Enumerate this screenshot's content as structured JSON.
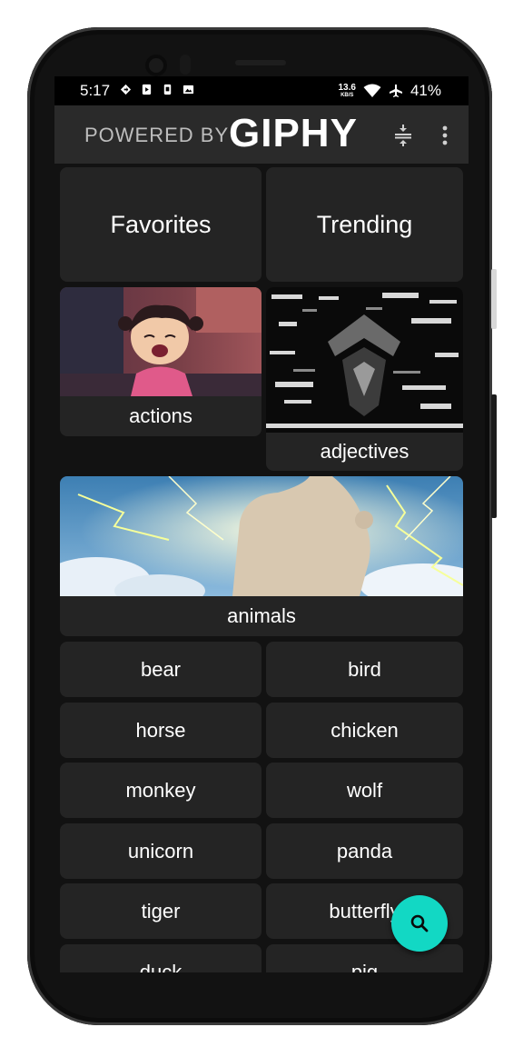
{
  "status_bar": {
    "time": "5:17",
    "speed_value": "13.6",
    "speed_unit": "KB/S",
    "battery": "41%"
  },
  "app_bar": {
    "powered_by": "POWERED BY",
    "brand": "GIPHY"
  },
  "top_tiles": [
    {
      "label": "Favorites"
    },
    {
      "label": "Trending"
    }
  ],
  "categories": [
    {
      "label": "actions"
    },
    {
      "label": "adjectives"
    },
    {
      "label": "animals"
    }
  ],
  "subcategories": [
    {
      "label": "bear"
    },
    {
      "label": "bird"
    },
    {
      "label": "horse"
    },
    {
      "label": "chicken"
    },
    {
      "label": "monkey"
    },
    {
      "label": "wolf"
    },
    {
      "label": "unicorn"
    },
    {
      "label": "panda"
    },
    {
      "label": "tiger"
    },
    {
      "label": "butterfly"
    },
    {
      "label": "duck"
    },
    {
      "label": "pig"
    }
  ],
  "colors": {
    "background": "#121212",
    "tile": "#242424",
    "app_bar": "#2a2a2a",
    "fab": "#12d8c4"
  },
  "icons": {
    "fab": "search-icon",
    "app_bar_actions": [
      "compress-icon",
      "more-vert-icon"
    ]
  }
}
